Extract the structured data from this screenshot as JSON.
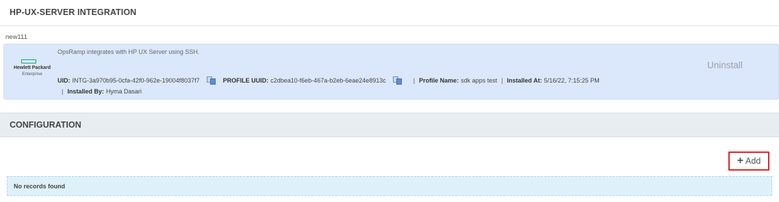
{
  "page": {
    "title": "HP-UX-SERVER INTEGRATION"
  },
  "instance": {
    "name": "new111"
  },
  "integration": {
    "logo": {
      "line1": "Hewlett Packard",
      "line2": "Enterprise",
      "brand_color": "#01a982"
    },
    "description": "OpsRamp integrates with HP UX Server using SSH.",
    "uid_label": "UID:",
    "uid_value": "INTG-3a970b95-0cfa-42f0-962e-19004f8037f7",
    "profile_uuid_label": "PROFILE UUID:",
    "profile_uuid_value": "c2dbea10-f6eb-467a-b2eb-6eae24e8913c",
    "profile_name_label": "Profile Name:",
    "profile_name_value": "sdk apps test",
    "installed_at_label": "Installed At:",
    "installed_at_value": "5/16/22, 7:15:25 PM",
    "installed_by_label": "Installed By:",
    "installed_by_value": "Hyma Dasari",
    "separator": "|",
    "uninstall_label": "Uninstall",
    "icons": {
      "copy": "copy-icon"
    }
  },
  "configuration": {
    "title": "CONFIGURATION",
    "add_label": "Add",
    "add_icon": "plus-icon",
    "empty_text": "No records found"
  },
  "colors": {
    "card_bg": "#dbe8fb",
    "highlight": "#e02424",
    "empty_bg": "#dff1f8"
  }
}
